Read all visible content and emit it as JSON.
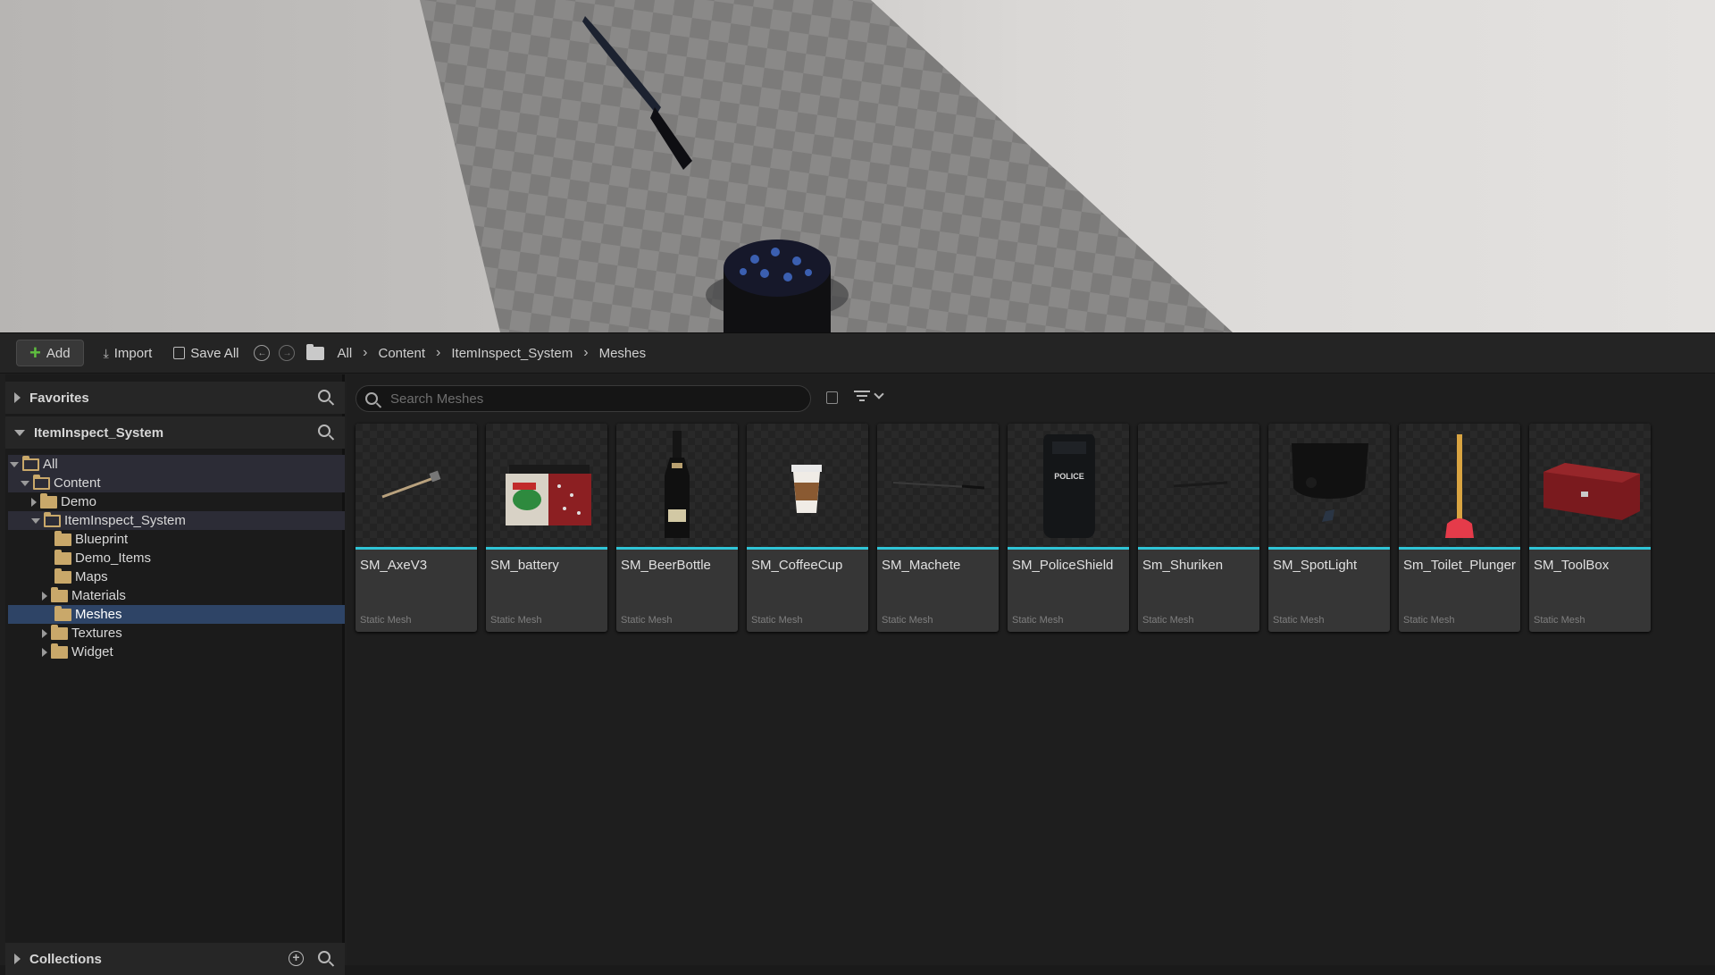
{
  "toolbar": {
    "add_label": "Add",
    "import_label": "Import",
    "save_all_label": "Save All",
    "breadcrumbs": [
      "All",
      "Content",
      "ItemInspect_System",
      "Meshes"
    ]
  },
  "left_panel": {
    "favorites_label": "Favorites",
    "project_label": "ItemInspect_System",
    "collections_label": "Collections",
    "tree": [
      {
        "label": "All",
        "state": "open",
        "depth": 0
      },
      {
        "label": "Content",
        "state": "open",
        "depth": 1
      },
      {
        "label": "Demo",
        "state": "closed",
        "depth": 2
      },
      {
        "label": "ItemInspect_System",
        "state": "open",
        "depth": 2
      },
      {
        "label": "Blueprint",
        "state": "leaf",
        "depth": 3
      },
      {
        "label": "Demo_Items",
        "state": "leaf",
        "depth": 3
      },
      {
        "label": "Maps",
        "state": "leaf",
        "depth": 3
      },
      {
        "label": "Materials",
        "state": "closed",
        "depth": 3
      },
      {
        "label": "Meshes",
        "state": "leaf",
        "depth": 3,
        "selected": true
      },
      {
        "label": "Textures",
        "state": "closed",
        "depth": 3
      },
      {
        "label": "Widget",
        "state": "closed",
        "depth": 3
      }
    ]
  },
  "search": {
    "placeholder": "Search Meshes"
  },
  "assets": [
    {
      "name": "SM_AxeV3",
      "type": "Static Mesh",
      "icon": "axe-thumbnail"
    },
    {
      "name": "SM_battery",
      "type": "Static Mesh",
      "icon": "battery-thumbnail"
    },
    {
      "name": "SM_BeerBottle",
      "type": "Static Mesh",
      "icon": "beer-bottle-thumbnail"
    },
    {
      "name": "SM_CoffeeCup",
      "type": "Static Mesh",
      "icon": "coffee-cup-thumbnail"
    },
    {
      "name": "SM_Machete",
      "type": "Static Mesh",
      "icon": "machete-thumbnail"
    },
    {
      "name": "SM_PoliceShield",
      "type": "Static Mesh",
      "icon": "police-shield-thumbnail"
    },
    {
      "name": "Sm_Shuriken",
      "type": "Static Mesh",
      "icon": "shuriken-thumbnail"
    },
    {
      "name": "SM_SpotLight",
      "type": "Static Mesh",
      "icon": "spotlight-thumbnail"
    },
    {
      "name": "Sm_Toilet_Plunger",
      "type": "Static Mesh",
      "icon": "plunger-thumbnail"
    },
    {
      "name": "SM_ToolBox",
      "type": "Static Mesh",
      "icon": "toolbox-thumbnail"
    }
  ],
  "thumbnail_text": {
    "shield_text": "POLICE"
  },
  "colors": {
    "accent_bar": "#2fc4d6",
    "selection": "#2e4466",
    "folder": "#c9a86a",
    "add_plus": "#5fbf3f"
  }
}
